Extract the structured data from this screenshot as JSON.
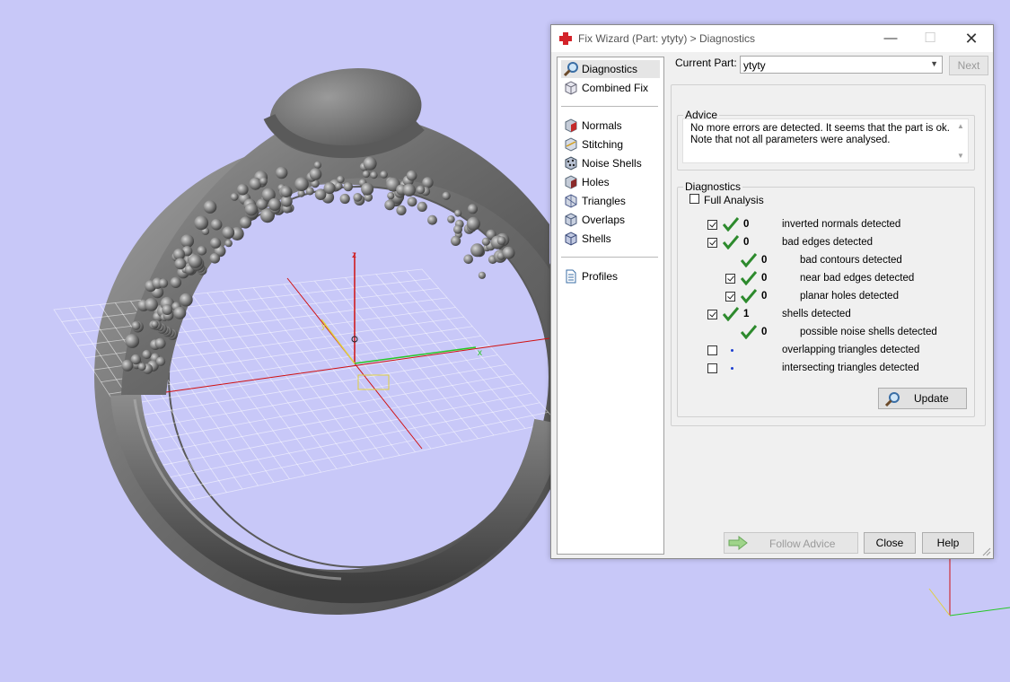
{
  "app": {
    "title": "Fix Wizard (Part: ytyty) > Diagnostics"
  },
  "window_controls": {
    "minimize": "—",
    "maximize": "☐",
    "close": "✕"
  },
  "viewport": {
    "axes": {
      "z": "z",
      "y": "y",
      "x": "x"
    }
  },
  "nav": {
    "items": [
      {
        "label": "Diagnostics",
        "icon": "magnifier-icon",
        "selected": true
      },
      {
        "label": "Combined Fix",
        "icon": "cube-icon"
      },
      {
        "label": "Normals",
        "icon": "normals-cube-icon"
      },
      {
        "label": "Stitching",
        "icon": "stitching-cube-icon"
      },
      {
        "label": "Noise Shells",
        "icon": "noise-shells-icon"
      },
      {
        "label": "Holes",
        "icon": "holes-cube-icon"
      },
      {
        "label": "Triangles",
        "icon": "triangles-cube-icon"
      },
      {
        "label": "Overlaps",
        "icon": "overlaps-cube-icon"
      },
      {
        "label": "Shells",
        "icon": "shells-cube-icon"
      },
      {
        "label": "Profiles",
        "icon": "document-icon"
      }
    ]
  },
  "part": {
    "label": "Current Part:",
    "value": "ytyty",
    "next_label": "Next"
  },
  "advice": {
    "title": "Advice",
    "line1": "No more errors are detected. It seems that the part is ok.",
    "line2": "Note that not all parameters were analysed."
  },
  "diagnostics": {
    "title": "Diagnostics",
    "full_analysis": "Full Analysis",
    "rows": [
      {
        "checked": true,
        "status": "ok",
        "count": "0",
        "label": "inverted normals detected"
      },
      {
        "checked": true,
        "status": "ok",
        "count": "0",
        "label": "bad edges detected"
      },
      {
        "checked": null,
        "status": "ok",
        "count": "0",
        "label": "bad contours detected"
      },
      {
        "checked": true,
        "status": "ok",
        "count": "0",
        "label": "near bad edges detected"
      },
      {
        "checked": true,
        "status": "ok",
        "count": "0",
        "label": "planar holes detected"
      },
      {
        "checked": true,
        "status": "ok",
        "count": "1",
        "label": "shells detected"
      },
      {
        "checked": null,
        "status": "ok",
        "count": "0",
        "label": "possible noise shells detected"
      },
      {
        "checked": false,
        "status": "not-analysed",
        "count": "",
        "label": "overlapping triangles detected"
      },
      {
        "checked": false,
        "status": "not-analysed",
        "count": "",
        "label": "intersecting triangles detected"
      }
    ],
    "update_label": "Update"
  },
  "footer": {
    "follow_advice": "Follow Advice",
    "close": "Close",
    "help": "Help"
  },
  "colors": {
    "background": "#c8c8f8",
    "check_green": "#2d8a2d",
    "axis_x": "#26c826",
    "axis_y": "#e0d040",
    "axis_z": "#d01010"
  }
}
